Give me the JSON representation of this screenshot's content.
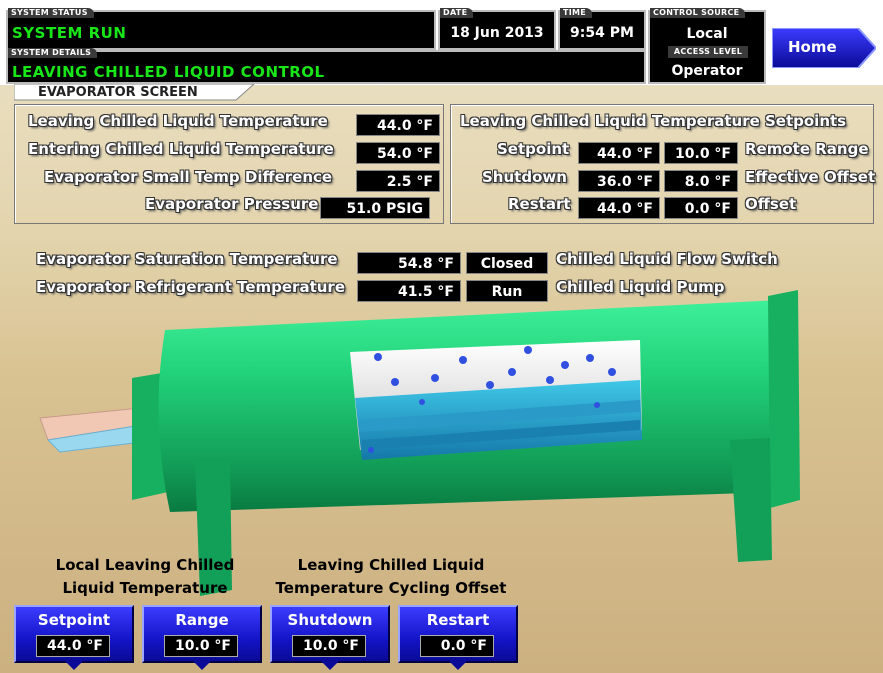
{
  "header": {
    "system_status_label": "SYSTEM STATUS",
    "system_status": "SYSTEM RUN",
    "system_details_label": "SYSTEM DETAILS",
    "system_details": "LEAVING CHILLED LIQUID CONTROL",
    "date_label": "DATE",
    "date": "18 Jun 2013",
    "time_label": "TIME",
    "time": "9:54 PM",
    "control_source_label": "CONTROL SOURCE",
    "control_source": "Local",
    "access_level_label": "ACCESS LEVEL",
    "access_level": "Operator",
    "home_button": "Home",
    "screen_tab": "EVAPORATOR SCREEN"
  },
  "left_panel": {
    "leaving_temp_label": "Leaving Chilled Liquid Temperature",
    "leaving_temp": "44.0 °F",
    "entering_temp_label": "Entering Chilled Liquid Temperature",
    "entering_temp": "54.0 °F",
    "small_temp_diff_label": "Evaporator Small Temp Difference",
    "small_temp_diff": "2.5 °F",
    "pressure_label": "Evaporator Pressure",
    "pressure": "51.0 PSIG"
  },
  "right_panel": {
    "title": "Leaving Chilled Liquid Temperature Setpoints",
    "setpoint_label": "Setpoint",
    "setpoint": "44.0 °F",
    "remote_range": "10.0 °F",
    "remote_range_label": "Remote Range",
    "shutdown_label": "Shutdown",
    "shutdown": "36.0 °F",
    "effective_offset": "8.0 °F",
    "effective_offset_label": "Effective Offset",
    "restart_label": "Restart",
    "restart": "44.0 °F",
    "offset": "0.0 °F",
    "offset_label": "Offset"
  },
  "middle": {
    "sat_temp_label": "Evaporator Saturation Temperature",
    "sat_temp": "54.8 °F",
    "flow_switch_status": "Closed",
    "flow_switch_label": "Chilled Liquid Flow Switch",
    "refrig_temp_label": "Evaporator Refrigerant Temperature",
    "refrig_temp": "41.5 °F",
    "pump_status": "Run",
    "pump_label": "Chilled Liquid Pump"
  },
  "bottom": {
    "local_caption_1": "Local Leaving Chilled",
    "local_caption_2": "Liquid Temperature",
    "cycling_caption_1": "Leaving Chilled Liquid",
    "cycling_caption_2": "Temperature Cycling Offset",
    "buttons": [
      {
        "label": "Setpoint",
        "value": "44.0 °F"
      },
      {
        "label": "Range",
        "value": "10.0 °F"
      },
      {
        "label": "Shutdown",
        "value": "10.0 °F"
      },
      {
        "label": "Restart",
        "value": "0.0 °F"
      }
    ]
  },
  "colors": {
    "status_green": "#19e619",
    "button_blue": "#1414c8",
    "evaporator_green": "#1ec86e"
  }
}
